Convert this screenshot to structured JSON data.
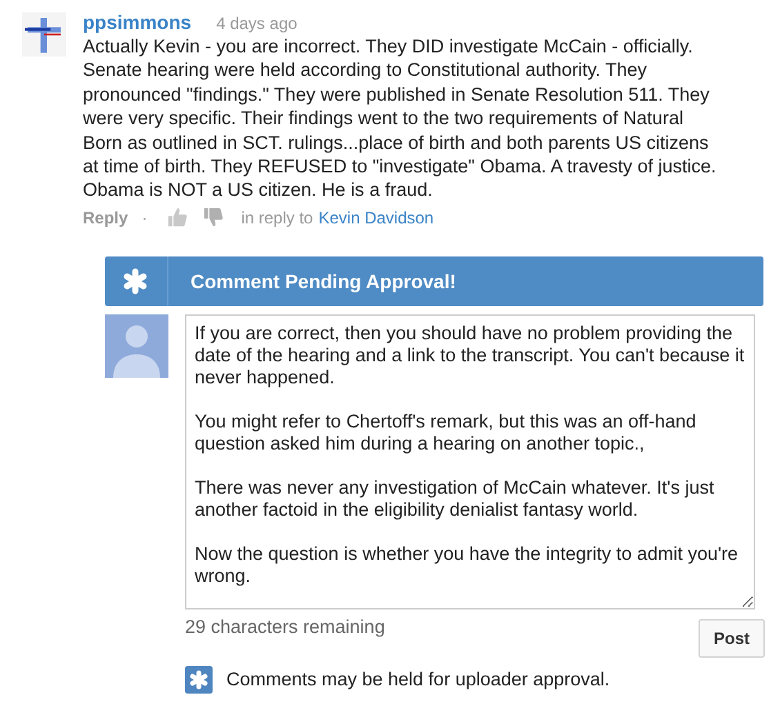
{
  "comment": {
    "author": "ppsimmons",
    "time": "4 days ago",
    "text": "Actually Kevin - you are incorrect. They DID investigate McCain - officially. Senate hearing were held according to Constitutional authority. They pronounced \"findings.\" They were published in Senate Resolution 511. They were very specific. Their findings went to the two requirements of Natural Born as outlined in SCT. rulings...place of birth and both parents US citizens at time of birth. They REFUSED to \"investigate\" Obama. A travesty of justice. Obama is NOT a US citizen. He is a fraud.",
    "reply": "Reply",
    "separator": "·",
    "in_reply_to": "in reply to",
    "reply_target": "Kevin Davidson"
  },
  "pending": {
    "title": "Comment Pending Approval!"
  },
  "draft": {
    "value": "If you are correct, then you should have no problem providing the date of the hearing and a link to the transcript. You can't because it never happened.\n\nYou might refer to Chertoff's remark, but this was an off-hand question asked him during a hearing on another topic.,\n\nThere was never any investigation of McCain whatever. It's just another factoid in the eligibility denialist fantasy world.\n\nNow the question is whether you have the integrity to admit you're wrong.",
    "remaining": "29 characters remaining",
    "post": "Post"
  },
  "notice": "Comments may be held for uploader approval."
}
